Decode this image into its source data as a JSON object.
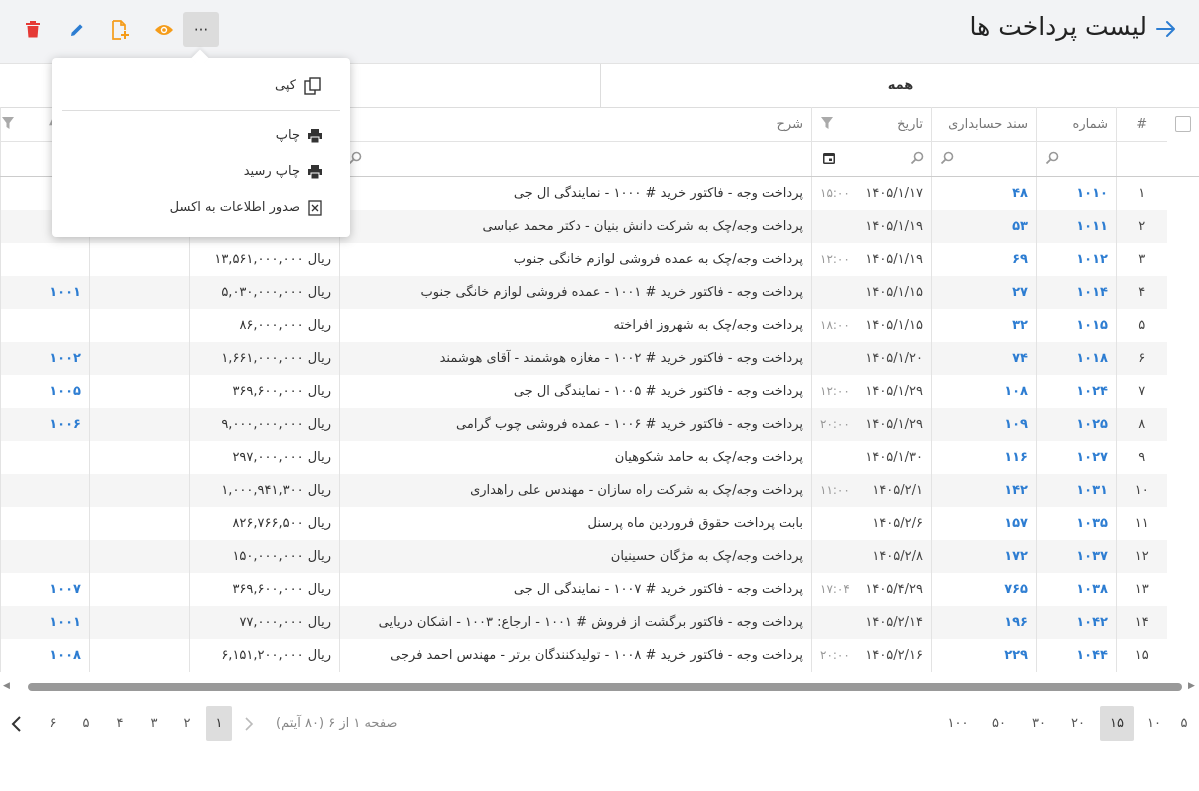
{
  "page": {
    "title": "لیست پرداخت ها"
  },
  "toolbar": {
    "more_label": "···"
  },
  "tabs": {
    "all": "همه"
  },
  "columns": {
    "index": "#",
    "number": "شماره",
    "voucher": "سند حسابداری",
    "date": "تاریخ",
    "desc": "شرح"
  },
  "menu": {
    "copy": "کپی",
    "print": "چاپ",
    "print_receipt": "چاپ رسید",
    "export_excel": "صدور اطلاعات به اکسل"
  },
  "rows": [
    {
      "idx": "۱",
      "num": "۱۰۱۰",
      "voucher": "۴۸",
      "date": "۱۴۰۵/۱/۱۷",
      "time": "۱۵:۰۰",
      "desc": "پرداخت وجه - فاکتور خرید # ۱۰۰۰ - نمایندگی ال جی",
      "amount": "",
      "ref": ""
    },
    {
      "idx": "۲",
      "num": "۱۰۱۱",
      "voucher": "۵۳",
      "date": "۱۴۰۵/۱/۱۹",
      "time": "",
      "desc": "پرداخت وجه/چک به شرکت دانش بنیان - دکتر محمد عباسی",
      "amount": "",
      "ref": ""
    },
    {
      "idx": "۳",
      "num": "۱۰۱۲",
      "voucher": "۶۹",
      "date": "۱۴۰۵/۱/۱۹",
      "time": "۱۲:۰۰",
      "desc": "پرداخت وجه/چک به عمده فروشی لوازم خانگی جنوب",
      "amount": "ریال ۱۳,۵۶۱,۰۰۰,۰۰۰",
      "ref": ""
    },
    {
      "idx": "۴",
      "num": "۱۰۱۴",
      "voucher": "۲۷",
      "date": "۱۴۰۵/۱/۱۵",
      "time": "",
      "desc": "پرداخت وجه - فاکتور خرید # ۱۰۰۱ - عمده فروشی لوازم خانگی جنوب",
      "amount": "ریال ۵,۰۳۰,۰۰۰,۰۰۰",
      "ref": "۱۰۰۱"
    },
    {
      "idx": "۵",
      "num": "۱۰۱۵",
      "voucher": "۳۲",
      "date": "۱۴۰۵/۱/۱۵",
      "time": "۱۸:۰۰",
      "desc": "پرداخت وجه/چک به شهروز افراخته",
      "amount": "ریال ۸۶,۰۰۰,۰۰۰",
      "ref": ""
    },
    {
      "idx": "۶",
      "num": "۱۰۱۸",
      "voucher": "۷۴",
      "date": "۱۴۰۵/۱/۲۰",
      "time": "",
      "desc": "پرداخت وجه - فاکتور خرید # ۱۰۰۲ - مغازه هوشمند - آقای هوشمند",
      "amount": "ریال ۱,۶۶۱,۰۰۰,۰۰۰",
      "ref": "۱۰۰۲"
    },
    {
      "idx": "۷",
      "num": "۱۰۲۴",
      "voucher": "۱۰۸",
      "date": "۱۴۰۵/۱/۲۹",
      "time": "۱۲:۰۰",
      "desc": "پرداخت وجه - فاکتور خرید # ۱۰۰۵ - نمایندگی ال جی",
      "amount": "ریال ۳۶۹,۶۰۰,۰۰۰",
      "ref": "۱۰۰۵"
    },
    {
      "idx": "۸",
      "num": "۱۰۲۵",
      "voucher": "۱۰۹",
      "date": "۱۴۰۵/۱/۲۹",
      "time": "۲۰:۰۰",
      "desc": "پرداخت وجه - فاکتور خرید # ۱۰۰۶ - عمده فروشی چوب گرامی",
      "amount": "ریال ۹,۰۰۰,۰۰۰,۰۰۰",
      "ref": "۱۰۰۶"
    },
    {
      "idx": "۹",
      "num": "۱۰۲۷",
      "voucher": "۱۱۶",
      "date": "۱۴۰۵/۱/۳۰",
      "time": "",
      "desc": "پرداخت وجه/چک به حامد شکوهیان",
      "amount": "ریال ۲۹۷,۰۰۰,۰۰۰",
      "ref": ""
    },
    {
      "idx": "۱۰",
      "num": "۱۰۳۱",
      "voucher": "۱۴۲",
      "date": "۱۴۰۵/۲/۱",
      "time": "۱۱:۰۰",
      "desc": "پرداخت وجه/چک به شرکت راه سازان - مهندس علی راهداری",
      "amount": "ریال ۱,۰۰۰,۹۴۱,۳۰۰",
      "ref": ""
    },
    {
      "idx": "۱۱",
      "num": "۱۰۳۵",
      "voucher": "۱۵۷",
      "date": "۱۴۰۵/۲/۶",
      "time": "",
      "desc": "بابت پرداخت حقوق فروردین ماه پرسنل",
      "amount": "ریال ۸۲۶,۷۶۶,۵۰۰",
      "ref": ""
    },
    {
      "idx": "۱۲",
      "num": "۱۰۳۷",
      "voucher": "۱۷۲",
      "date": "۱۴۰۵/۲/۸",
      "time": "",
      "desc": "پرداخت وجه/چک به مژگان حسینیان",
      "amount": "ریال ۱۵۰,۰۰۰,۰۰۰",
      "ref": ""
    },
    {
      "idx": "۱۳",
      "num": "۱۰۳۸",
      "voucher": "۷۶۵",
      "date": "۱۴۰۵/۴/۲۹",
      "time": "۱۷:۰۴",
      "desc": "پرداخت وجه - فاکتور خرید # ۱۰۰۷ - نمایندگی ال جی",
      "amount": "ریال ۳۶۹,۶۰۰,۰۰۰",
      "ref": "۱۰۰۷"
    },
    {
      "idx": "۱۴",
      "num": "۱۰۴۲",
      "voucher": "۱۹۶",
      "date": "۱۴۰۵/۲/۱۴",
      "time": "",
      "desc": "پرداخت وجه - فاکتور برگشت از فروش # ۱۰۰۱ - ارجاع: ۱۰۰۳ - اشکان دریایی",
      "amount": "ریال ۷۷,۰۰۰,۰۰۰",
      "ref": "۱۰۰۱"
    },
    {
      "idx": "۱۵",
      "num": "۱۰۴۴",
      "voucher": "۲۲۹",
      "date": "۱۴۰۵/۲/۱۶",
      "time": "۲۰:۰۰",
      "desc": "پرداخت وجه - فاکتور خرید # ۱۰۰۸ - تولیدکنندگان برتر - مهندس احمد فرجی",
      "amount": "ریال ۶,۱۵۱,۲۰۰,۰۰۰",
      "ref": "۱۰۰۸"
    }
  ],
  "pager": {
    "info": "صفحه ۱ از ۶ (۸۰ آیتم)",
    "pages": [
      "۱",
      "۲",
      "۳",
      "۴",
      "۵",
      "۶"
    ],
    "current": "۱",
    "sizes": [
      "۵",
      "۱۰",
      "۱۵",
      "۲۰",
      "۳۰",
      "۵۰",
      "۱۰۰"
    ],
    "current_size": "۱۵"
  },
  "colors": {
    "accent": "#2d7dd2",
    "delete": "#e53935",
    "edit": "#2d7dd2",
    "add": "#f59c1a",
    "view": "#f59c1a"
  }
}
